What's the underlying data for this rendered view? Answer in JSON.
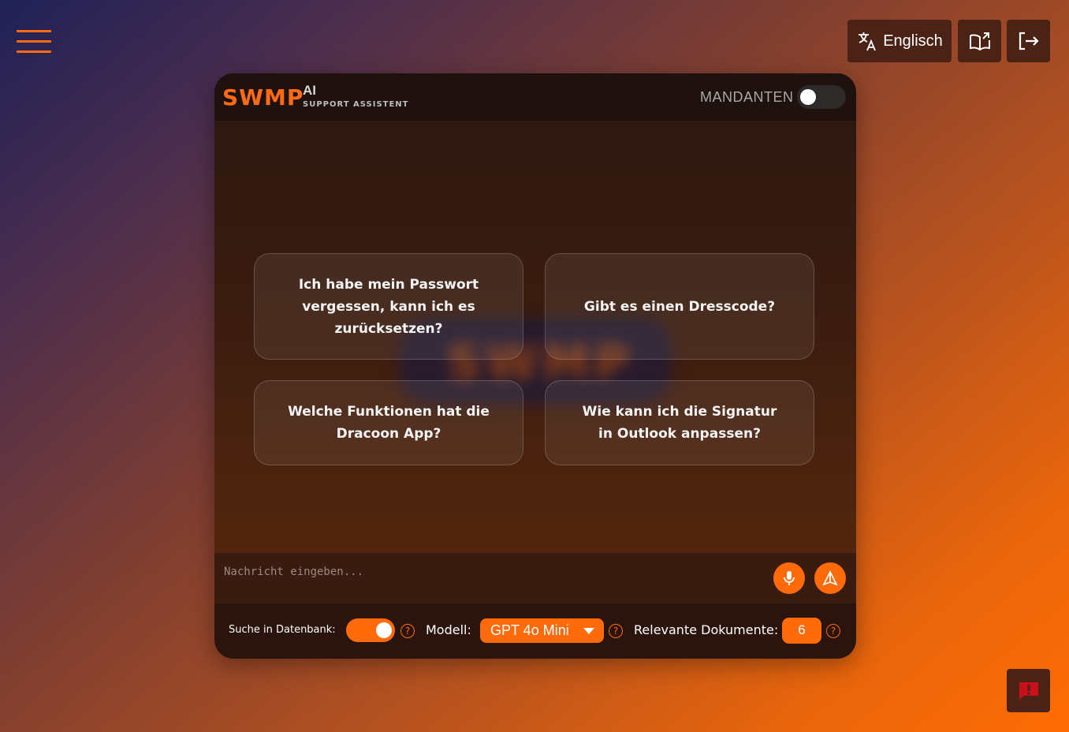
{
  "header": {
    "language_label": "Englisch",
    "icons": [
      "menu-icon",
      "translate-icon",
      "book-open-icon",
      "logout-icon"
    ]
  },
  "card": {
    "brand": "SWMP",
    "brand_ai": "AI",
    "subtitle": "SUPPORT ASSISTENT",
    "mandanten_label": "MANDANTEN",
    "mandanten_enabled": false
  },
  "suggestions": [
    "Ich habe mein Passwort vergessen, kann ich es zurücksetzen?",
    "Gibt es einen Dresscode?",
    "Welche Funktionen hat die Dracoon App?",
    "Wie kann ich die Signatur in Outlook anpassen?"
  ],
  "input": {
    "placeholder": "Nachricht eingeben..."
  },
  "settings": {
    "db_search_label": "Suche in Datenbank:",
    "db_search_enabled": true,
    "model_label": "Modell:",
    "model_value": "GPT 4o Mini",
    "docs_label": "Relevante Dokumente:",
    "docs_value": "6",
    "help_symbol": "?"
  },
  "colors": {
    "accent": "#ff6b0a",
    "button_bg": "#4a2316",
    "feedback_icon": "#c8101a"
  }
}
